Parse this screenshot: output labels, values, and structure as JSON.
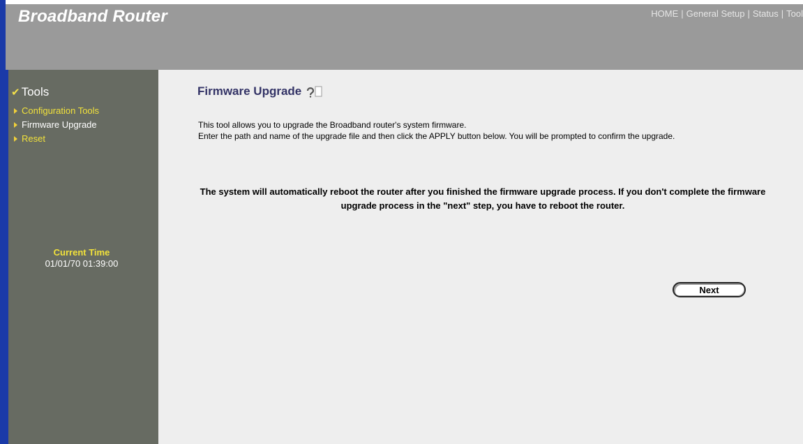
{
  "header": {
    "brand": "Broadband Router",
    "nav": [
      {
        "label": "HOME"
      },
      {
        "label": "General Setup"
      },
      {
        "label": "Status"
      },
      {
        "label": "Tool"
      }
    ]
  },
  "sidebar": {
    "heading": "Tools",
    "items": [
      {
        "label": "Configuration Tools"
      },
      {
        "label": "Firmware Upgrade"
      },
      {
        "label": "Reset"
      }
    ],
    "time_label": "Current Time",
    "time_value": "01/01/70 01:39:00"
  },
  "main": {
    "title": "Firmware Upgrade",
    "description": [
      "This tool allows you to upgrade the Broadband router's system firmware.",
      "Enter the path and name of the upgrade file and then click the APPLY button below. You will be prompted to confirm the upgrade."
    ],
    "warning": "The system will automatically reboot the router after you finished the firmware upgrade process. If you don't complete the firmware upgrade process in the \"next\" step, you have to reboot the router.",
    "next_label": "Next"
  },
  "colors": {
    "header_bg": "#9a9a9a",
    "sidebar_bg": "#676b62",
    "accent_stripe": "#1a3aa8",
    "menu_yellow": "#f2e23b",
    "main_bg": "#eeeeee",
    "title_color": "#333366"
  },
  "icons": {
    "heading_icon": "checkmark-icon",
    "menu_bullet": "triangle-right-icon",
    "title_icon": "help-icon"
  }
}
